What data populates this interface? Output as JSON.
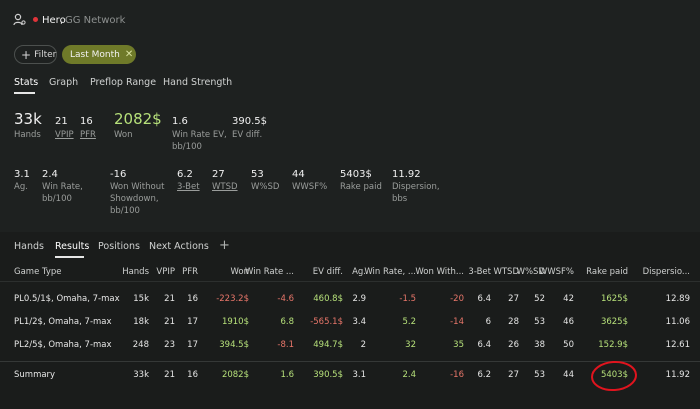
{
  "header": {
    "player": "Hero",
    "separator": ",",
    "network": "GG Network"
  },
  "colors": {
    "accent_green": "#b6e07a",
    "negative_red": "#e8766a",
    "chip_active": "#6f7a29",
    "highlight_circle": "#e0141e"
  },
  "filters": {
    "add_label": "Filter",
    "active_label": "Last Month"
  },
  "top_tabs": [
    "Stats",
    "Graph",
    "Preflop Range",
    "Hand Strength"
  ],
  "stats_row1": {
    "hands": {
      "value": "33k",
      "label": "Hands"
    },
    "vpip": {
      "value": "21",
      "label": "VPIP"
    },
    "pfr": {
      "value": "16",
      "label": "PFR"
    },
    "won": {
      "value": "2082$",
      "label": "Won"
    },
    "winrate_ev": {
      "value": "1.6",
      "label1": "Win Rate EV,",
      "label2": "bb/100"
    },
    "ev_diff": {
      "value": "390.5$",
      "label": "EV diff."
    }
  },
  "stats_row2": {
    "ag": {
      "value": "3.1",
      "label": "Ag."
    },
    "winrate": {
      "value": "2.4",
      "label1": "Win Rate,",
      "label2": "bb/100"
    },
    "won_wo_sd": {
      "value": "-16",
      "label1": "Won Without",
      "label2": "Showdown,",
      "label3": "bb/100"
    },
    "threebet": {
      "value": "6.2",
      "label": "3-Bet"
    },
    "wtsd": {
      "value": "27",
      "label": "WTSD"
    },
    "wsd": {
      "value": "53",
      "label": "W%SD"
    },
    "wwsf": {
      "value": "44",
      "label": "WWSF%"
    },
    "rake": {
      "value": "5403$",
      "label": "Rake paid"
    },
    "dispersion": {
      "value": "11.92",
      "label1": "Dispersion,",
      "label2": "bbs"
    }
  },
  "bottom_tabs": [
    "Hands",
    "Results",
    "Positions",
    "Next Actions",
    "+"
  ],
  "table": {
    "headers": [
      "Game Type",
      "Hands",
      "VPIP",
      "PFR",
      "Won",
      "Win Rate ...",
      "EV diff.",
      "Ag.",
      "Win Rate, ...",
      "Won With...",
      "3-Bet",
      "WTSD",
      "W%SD",
      "WWSF%",
      "Rake paid",
      "Dispersio..."
    ],
    "rows": [
      [
        "PL0.5/1$, Omaha, 7-max",
        "15k",
        "21",
        "16",
        "-223.2$",
        "-4.6",
        "460.8$",
        "2.9",
        "-1.5",
        "-20",
        "6.4",
        "27",
        "52",
        "42",
        "1625$",
        "12.89"
      ],
      [
        "PL1/2$, Omaha, 7-max",
        "18k",
        "21",
        "17",
        "1910$",
        "6.8",
        "-565.1$",
        "3.4",
        "5.2",
        "-14",
        "6",
        "28",
        "53",
        "46",
        "3625$",
        "11.06"
      ],
      [
        "PL2/5$, Omaha, 7-max",
        "248",
        "23",
        "17",
        "394.5$",
        "-8.1",
        "494.7$",
        "2",
        "32",
        "35",
        "6.4",
        "26",
        "38",
        "50",
        "152.9$",
        "12.61"
      ]
    ],
    "summary": [
      "Summary",
      "33k",
      "21",
      "16",
      "2082$",
      "1.6",
      "390.5$",
      "3.1",
      "2.4",
      "-16",
      "6.2",
      "27",
      "53",
      "44",
      "5403$",
      "11.92"
    ]
  }
}
